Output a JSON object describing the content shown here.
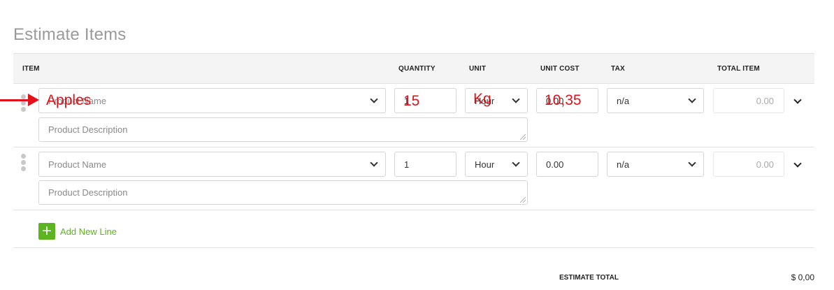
{
  "section": {
    "title": "Estimate Items"
  },
  "table": {
    "headers": {
      "item": "ITEM",
      "quantity": "QUANTITY",
      "unit": "UNIT",
      "unit_cost": "UNIT COST",
      "tax": "TAX",
      "total_item": "TOTAL ITEM"
    },
    "rows": [
      {
        "product_placeholder": "Product Name",
        "description_placeholder": "Product Description",
        "quantity": "1",
        "unit": "Hour",
        "unit_cost": "0.00",
        "tax": "n/a",
        "total": "0.00"
      },
      {
        "product_placeholder": "Product Name",
        "description_placeholder": "Product Description",
        "quantity": "1",
        "unit": "Hour",
        "unit_cost": "0.00",
        "tax": "n/a",
        "total": "0.00"
      }
    ]
  },
  "add_line": {
    "label": "Add New Line",
    "icon": "+"
  },
  "estimate_total": {
    "label": "ESTIMATE TOTAL",
    "value": "$ 0,00"
  },
  "annotations": {
    "color": "#e3111b",
    "product": "Apples",
    "quantity": "15",
    "unit": "Kg",
    "unit_cost": "10,35"
  },
  "colors": {
    "accent_green": "#5cb41e",
    "header_bg": "#f4f4f4"
  }
}
